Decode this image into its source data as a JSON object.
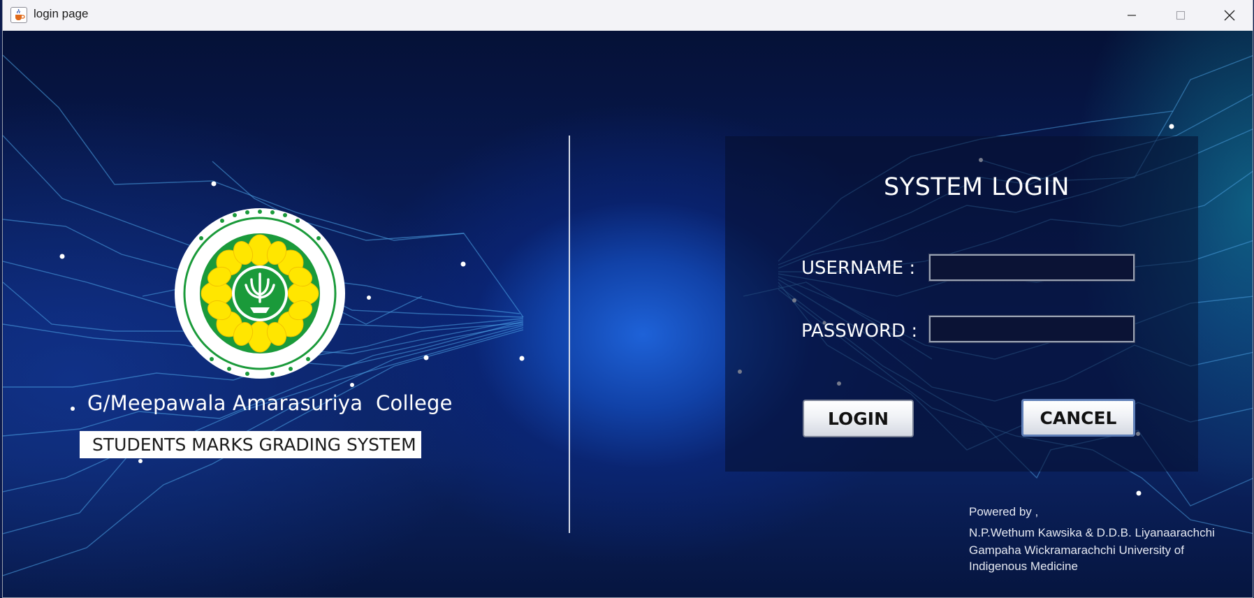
{
  "window": {
    "title": "login page",
    "icon": "java-cup-icon"
  },
  "controls": {
    "minimize_icon": "minimize-icon",
    "maximize_icon": "maximize-icon",
    "close_icon": "close-icon"
  },
  "branding": {
    "college_name": "G/Meepawala Amarasuriya  College",
    "system_name": "STUDENTS MARKS GRADING SYSTEM",
    "logo_icon": "college-crest-logo"
  },
  "login": {
    "title": "SYSTEM LOGIN",
    "username_label": "USERNAME :",
    "username_value": "",
    "password_label": "PASSWORD :",
    "password_value": "",
    "login_button": "LOGIN",
    "cancel_button": "CANCEL"
  },
  "credits": {
    "powered_by": "Powered by ,",
    "authors": "N.P.Wethum Kawsika & D.D.B. Liyanaarachchi",
    "university_line1": "Gampaha Wickramarachchi University of",
    "university_line2": "Indigenous Medicine"
  },
  "colors": {
    "background_dark": "#051137",
    "background_glow": "#1e62d8",
    "panel": "#060e2e",
    "text": "#ffffff",
    "logo_green": "#1a9a3a",
    "logo_yellow": "#ffe600"
  }
}
